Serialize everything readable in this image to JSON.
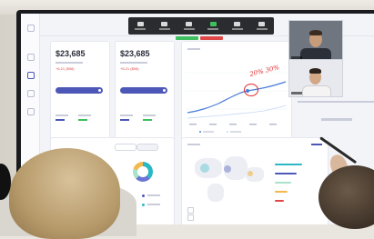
{
  "scene": {
    "description_tag": "photo-of-smart-display-video-conference"
  },
  "dashboard": {
    "card1": {
      "value": "$23,685",
      "delta": "+6.21 ($98)"
    },
    "card2": {
      "value": "$23,685",
      "delta": "+6.21 ($98)"
    },
    "annotation": "20% 30%"
  },
  "toolbar": {
    "icons": [
      "mic-icon",
      "camera-icon",
      "share-icon",
      "record-icon",
      "participants-icon",
      "leave-icon"
    ]
  },
  "colors": {
    "accent": "#4d57b8",
    "annotation": "#e02d2d",
    "line": "#4a7fd8",
    "bezel": "#1a1b1e"
  }
}
